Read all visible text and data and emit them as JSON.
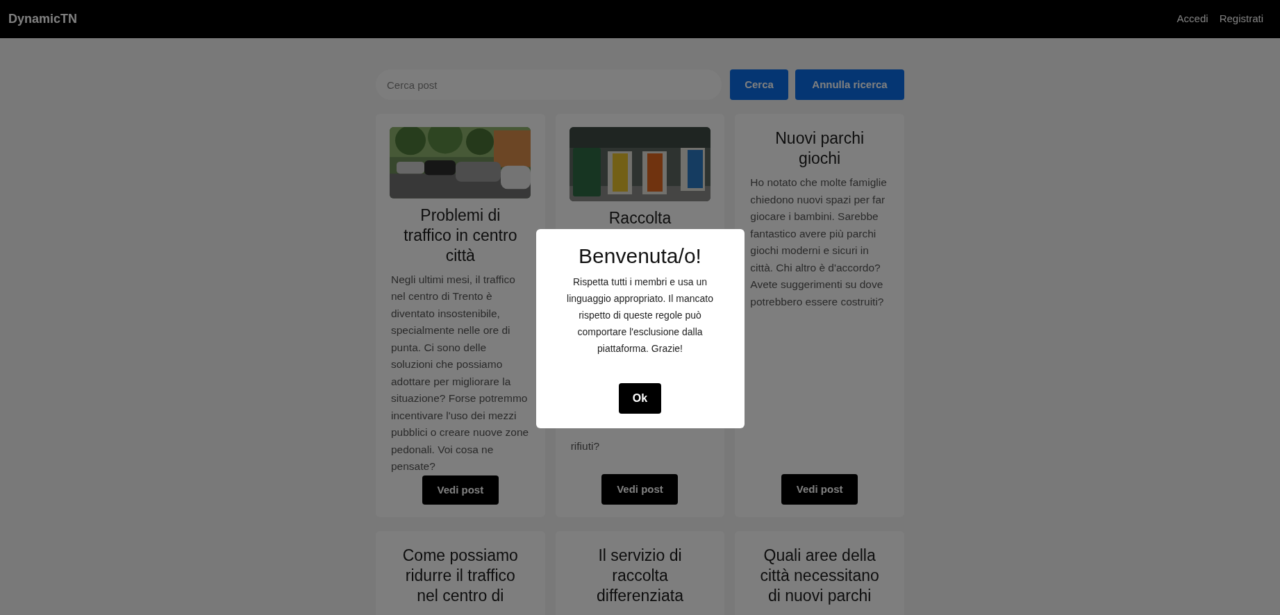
{
  "navbar": {
    "brand": "DynamicTN",
    "links": [
      "Accedi",
      "Registrati"
    ]
  },
  "search": {
    "placeholder": "Cerca post",
    "buttons": [
      "Cerca",
      "Annulla ricerca"
    ]
  },
  "posts": [
    {
      "kind": "post",
      "title": "Problemi di traffico in centro città",
      "body": "Negli ultimi mesi, il traffico nel centro di Trento è diventato insostenibile, specialmente nelle ore di punta. Ci sono delle soluzioni che possiamo adottare per migliorare la situazione? Forse potremmo incentivare l'uso dei mezzi pubblici o creare nuove zone pedonali. Voi cosa ne pensate?",
      "button": "Vedi post"
    },
    {
      "kind": "covered",
      "title": "Raccolta",
      "body": "rifiuti?",
      "button": "Vedi post"
    },
    {
      "kind": "post",
      "title": "Nuovi parchi giochi",
      "body": "Ho notato che molte famiglie chiedono nuovi spazi per far giocare i bambini. Sarebbe fantastico avere più parchi giochi moderni e sicuri in città. Chi altro è d'accordo? Avete suggerimenti su dove potrebbero essere costruiti?",
      "button": "Vedi post"
    },
    {
      "title": "Come possiamo ridurre il traffico nel centro di"
    },
    {
      "title": "Il servizio di raccolta differenziata"
    },
    {
      "title": "Quali aree della città necessitano di nuovi parchi"
    }
  ],
  "modal": {
    "title": "Benvenuta/o!",
    "message": "Rispetta tutti i membri e usa un linguaggio appropriato. Il mancato rispetto di queste regole può comportare l'esclusione dalla piattaforma. Grazie!",
    "button": "Ok"
  }
}
